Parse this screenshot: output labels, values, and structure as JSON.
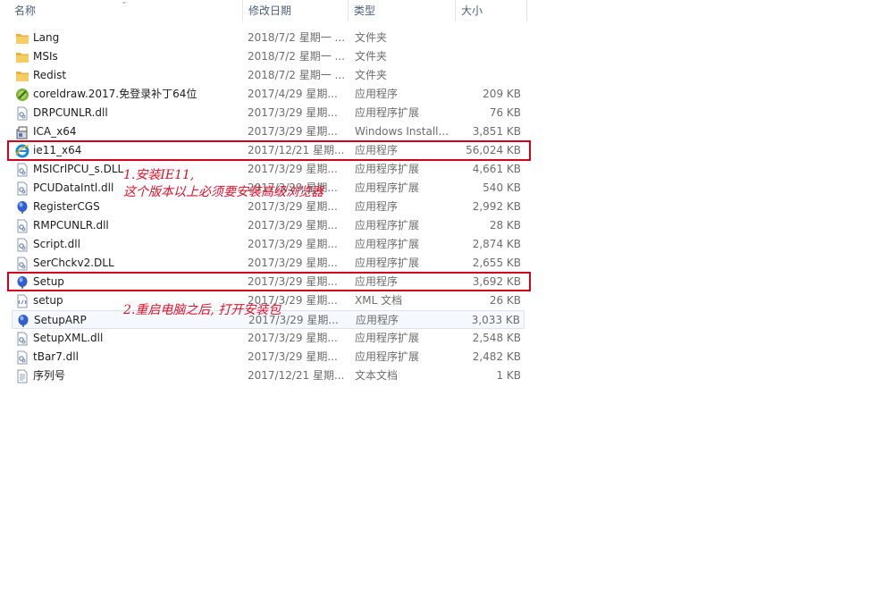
{
  "columns": {
    "name": "名称",
    "modified": "修改日期",
    "type": "类型",
    "size": "大小"
  },
  "files": [
    {
      "name": "Lang",
      "modified": "2018/7/2 星期一 ...",
      "type": "文件夹",
      "size": "",
      "icon": "folder-icon"
    },
    {
      "name": "MSIs",
      "modified": "2018/7/2 星期一 ...",
      "type": "文件夹",
      "size": "",
      "icon": "folder-icon"
    },
    {
      "name": "Redist",
      "modified": "2018/7/2 星期一 ...",
      "type": "文件夹",
      "size": "",
      "icon": "folder-icon"
    },
    {
      "name": "coreldraw.2017.免登录补丁64位",
      "modified": "2017/4/29 星期...",
      "type": "应用程序",
      "size": "209 KB",
      "icon": "coreldraw-icon"
    },
    {
      "name": "DRPCUNLR.dll",
      "modified": "2017/3/29 星期...",
      "type": "应用程序扩展",
      "size": "76 KB",
      "icon": "dll-file-icon"
    },
    {
      "name": "ICA_x64",
      "modified": "2017/3/29 星期...",
      "type": "Windows Install...",
      "size": "3,851 KB",
      "icon": "installer-package-icon"
    },
    {
      "name": "ie11_x64",
      "modified": "2017/12/21 星期...",
      "type": "应用程序",
      "size": "56,024 KB",
      "icon": "internet-explorer-icon"
    },
    {
      "name": "MSICrlPCU_s.DLL",
      "modified": "2017/3/29 星期...",
      "type": "应用程序扩展",
      "size": "4,661 KB",
      "icon": "dll-file-icon"
    },
    {
      "name": "PCUDataIntl.dll",
      "modified": "2017/3/29 星期...",
      "type": "应用程序扩展",
      "size": "540 KB",
      "icon": "dll-file-icon"
    },
    {
      "name": "RegisterCGS",
      "modified": "2017/3/29 星期...",
      "type": "应用程序",
      "size": "2,992 KB",
      "icon": "corel-balloon-icon"
    },
    {
      "name": "RMPCUNLR.dll",
      "modified": "2017/3/29 星期...",
      "type": "应用程序扩展",
      "size": "28 KB",
      "icon": "dll-file-icon"
    },
    {
      "name": "Script.dll",
      "modified": "2017/3/29 星期...",
      "type": "应用程序扩展",
      "size": "2,874 KB",
      "icon": "dll-file-icon"
    },
    {
      "name": "SerChckv2.DLL",
      "modified": "2017/3/29 星期...",
      "type": "应用程序扩展",
      "size": "2,655 KB",
      "icon": "dll-file-icon"
    },
    {
      "name": "Setup",
      "modified": "2017/3/29 星期...",
      "type": "应用程序",
      "size": "3,692 KB",
      "icon": "corel-balloon-icon"
    },
    {
      "name": "setup",
      "modified": "2017/3/29 星期...",
      "type": "XML 文档",
      "size": "26 KB",
      "icon": "xml-file-icon"
    },
    {
      "name": "SetupARP",
      "modified": "2017/3/29 星期...",
      "type": "应用程序",
      "size": "3,033 KB",
      "icon": "corel-balloon-icon"
    },
    {
      "name": "SetupXML.dll",
      "modified": "2017/3/29 星期...",
      "type": "应用程序扩展",
      "size": "2,548 KB",
      "icon": "dll-file-icon"
    },
    {
      "name": "tBar7.dll",
      "modified": "2017/3/29 星期...",
      "type": "应用程序扩展",
      "size": "2,482 KB",
      "icon": "dll-file-icon"
    },
    {
      "name": "序列号",
      "modified": "2017/12/21 星期...",
      "type": "文本文档",
      "size": "1 KB",
      "icon": "text-file-icon"
    }
  ],
  "annotations": {
    "step1_line1": "1.安装IE11,",
    "step1_line2": "这个版本以上必须要安装高级浏览器",
    "step2": "2.重启电脑之后, 打开安装包"
  },
  "colors": {
    "annotation": "#d1001d",
    "folder": "#e8b441",
    "row_hover": "#f5f8fd"
  }
}
